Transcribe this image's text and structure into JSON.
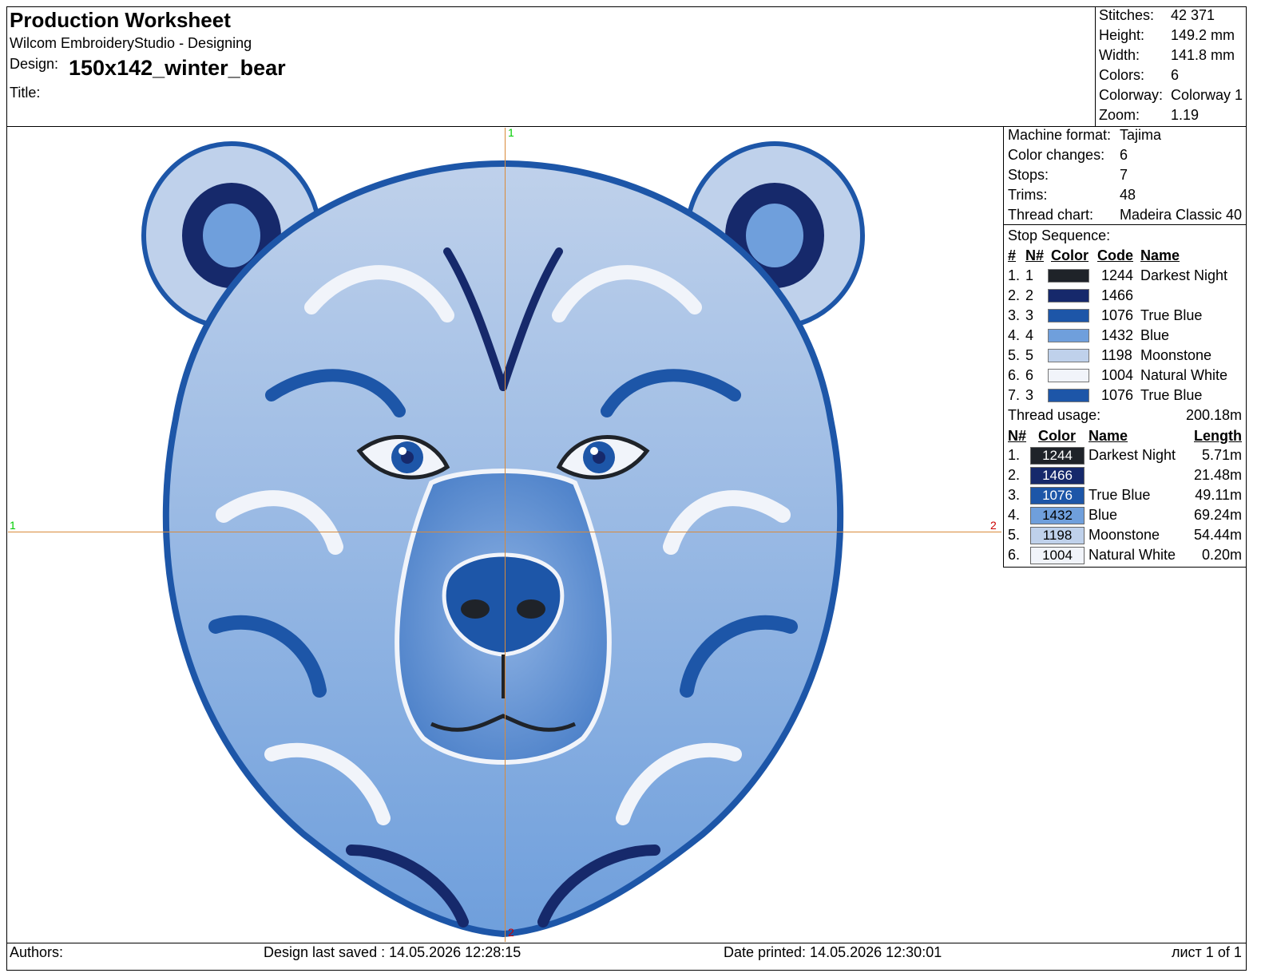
{
  "header": {
    "title": "Production Worksheet",
    "app": "Wilcom EmbroideryStudio - Designing",
    "design_label": "Design:",
    "design_value": "150x142_winter_bear",
    "title_label": "Title:"
  },
  "stats": [
    {
      "key": "Stitches:",
      "value": "42 371"
    },
    {
      "key": "Height:",
      "value": "149.2 mm"
    },
    {
      "key": "Width:",
      "value": "141.8 mm"
    },
    {
      "key": "Colors:",
      "value": "6"
    },
    {
      "key": "Colorway:",
      "value": "Colorway 1"
    },
    {
      "key": "Zoom:",
      "value": "1.19"
    }
  ],
  "machine": [
    {
      "key": "Machine format:",
      "value": "Tajima"
    },
    {
      "key": "Color changes:",
      "value": "6"
    },
    {
      "key": "Stops:",
      "value": "7"
    },
    {
      "key": "Trims:",
      "value": "48"
    },
    {
      "key": "Thread chart:",
      "value": "Madeira Classic 40"
    }
  ],
  "stop_sequence": {
    "title": "Stop Sequence:",
    "headers": {
      "idx": "#",
      "n": "N#",
      "color": "Color",
      "code": "Code",
      "name": "Name"
    },
    "rows": [
      {
        "idx": "1.",
        "n": "1",
        "color": "#1f2329",
        "code": "1244",
        "name": "Darkest Night"
      },
      {
        "idx": "2.",
        "n": "2",
        "color": "#16296b",
        "code": "1466",
        "name": ""
      },
      {
        "idx": "3.",
        "n": "3",
        "color": "#1d56a8",
        "code": "1076",
        "name": "True Blue"
      },
      {
        "idx": "4.",
        "n": "4",
        "color": "#6f9fdc",
        "code": "1432",
        "name": "Blue"
      },
      {
        "idx": "5.",
        "n": "5",
        "color": "#bfd1eb",
        "code": "1198",
        "name": "Moonstone"
      },
      {
        "idx": "6.",
        "n": "6",
        "color": "#f1f4fa",
        "code": "1004",
        "name": "Natural White"
      },
      {
        "idx": "7.",
        "n": "3",
        "color": "#1d56a8",
        "code": "1076",
        "name": "True Blue"
      }
    ]
  },
  "thread_usage": {
    "label": "Thread usage:",
    "total": "200.18m",
    "headers": {
      "n": "N#",
      "color": "Color",
      "name": "Name",
      "length": "Length"
    },
    "rows": [
      {
        "n": "1.",
        "color": "#1f2329",
        "text_color": "#ffffff",
        "code": "1244",
        "name": "Darkest Night",
        "length": "5.71m"
      },
      {
        "n": "2.",
        "color": "#16296b",
        "text_color": "#ffffff",
        "code": "1466",
        "name": "",
        "length": "21.48m"
      },
      {
        "n": "3.",
        "color": "#1d56a8",
        "text_color": "#ffffff",
        "code": "1076",
        "name": "True Blue",
        "length": "49.11m"
      },
      {
        "n": "4.",
        "color": "#6f9fdc",
        "text_color": "#000000",
        "code": "1432",
        "name": "Blue",
        "length": "69.24m"
      },
      {
        "n": "5.",
        "color": "#bfd1eb",
        "text_color": "#000000",
        "code": "1198",
        "name": "Moonstone",
        "length": "54.44m"
      },
      {
        "n": "6.",
        "color": "#f1f4fa",
        "text_color": "#000000",
        "code": "1004",
        "name": "Natural White",
        "length": "0.20m"
      }
    ]
  },
  "axis_labels": {
    "top": "1",
    "left": "1",
    "right": "2",
    "bottom": "2"
  },
  "footer": {
    "authors": "Authors:",
    "saved": "Design last saved : 14.05.2026 12:28:15",
    "printed": "Date printed: 14.05.2026 12:30:01",
    "page": "лист 1 of 1"
  }
}
